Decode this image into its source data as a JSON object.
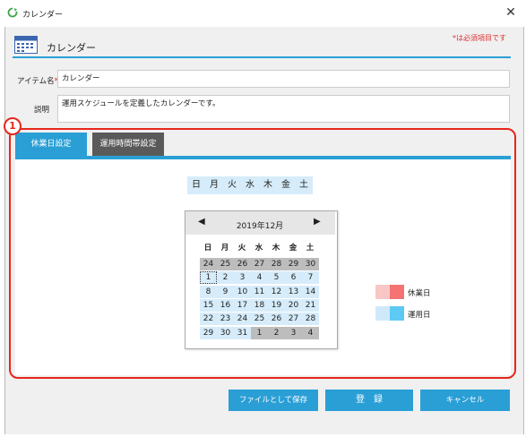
{
  "window": {
    "title": "カレンダー"
  },
  "header": {
    "title": "カレンダー",
    "required_note": "*は必須項目です"
  },
  "form": {
    "item_name_label": "アイテム名",
    "required_mark": "*",
    "item_name_value": "カレンダー",
    "description_label": "説明",
    "description_value": "運用スケジュールを定義したカレンダーです。"
  },
  "annotation_number": "1",
  "tabs": [
    {
      "label": "休業日設定",
      "active": true
    },
    {
      "label": "運用時間帯設定",
      "active": false
    }
  ],
  "weekdays": [
    "日",
    "月",
    "火",
    "水",
    "木",
    "金",
    "土"
  ],
  "calendar": {
    "month_label": "2019年12月",
    "prev_icon": "◀",
    "next_icon": "▶",
    "dow": [
      "日",
      "月",
      "火",
      "水",
      "木",
      "金",
      "土"
    ],
    "weeks": [
      [
        "24",
        "25",
        "26",
        "27",
        "28",
        "29",
        "30"
      ],
      [
        "1",
        "2",
        "3",
        "4",
        "5",
        "6",
        "7"
      ],
      [
        "8",
        "9",
        "10",
        "11",
        "12",
        "13",
        "14"
      ],
      [
        "15",
        "16",
        "17",
        "18",
        "19",
        "20",
        "21"
      ],
      [
        "22",
        "23",
        "24",
        "25",
        "26",
        "27",
        "28"
      ],
      [
        "29",
        "30",
        "31",
        "1",
        "2",
        "3",
        "4"
      ]
    ]
  },
  "legend": [
    {
      "label": "休業日",
      "colors": [
        "#f9c6c6",
        "#f47373"
      ]
    },
    {
      "label": "運用日",
      "colors": [
        "#cfe9fb",
        "#5ccaf3"
      ]
    }
  ],
  "buttons": {
    "save_file": "ファイルとして保存",
    "register": "登　録",
    "cancel": "キャンセル"
  },
  "colors": {
    "accent": "#2a9fd6",
    "highlight": "#e8261c",
    "tab_inactive": "#5a5a5a"
  }
}
